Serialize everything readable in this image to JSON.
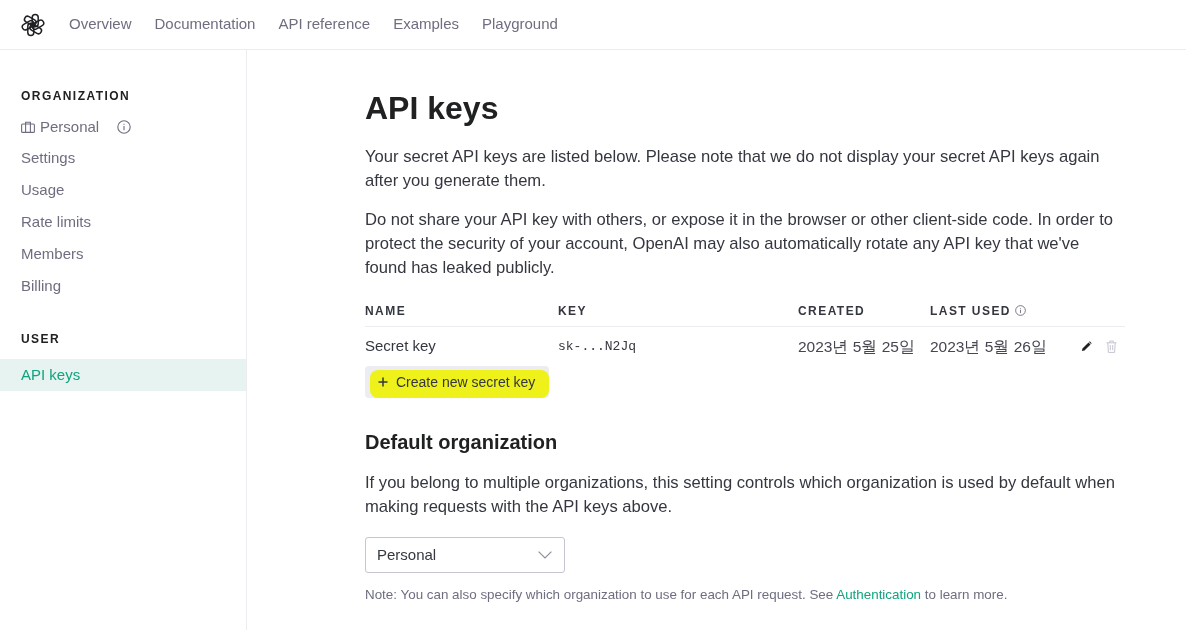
{
  "nav": {
    "items": [
      "Overview",
      "Documentation",
      "API reference",
      "Examples",
      "Playground"
    ]
  },
  "sidebar": {
    "sections": [
      {
        "heading": "ORGANIZATION",
        "items": [
          {
            "kind": "org",
            "label": "Personal",
            "selected": false
          },
          {
            "kind": "link",
            "label": "Settings",
            "selected": false
          },
          {
            "kind": "link",
            "label": "Usage",
            "selected": false
          },
          {
            "kind": "link",
            "label": "Rate limits",
            "selected": false
          },
          {
            "kind": "link",
            "label": "Members",
            "selected": false
          },
          {
            "kind": "link",
            "label": "Billing",
            "selected": false
          }
        ]
      },
      {
        "heading": "USER",
        "items": [
          {
            "kind": "link",
            "label": "API keys",
            "selected": true
          }
        ]
      }
    ]
  },
  "main": {
    "title": "API keys",
    "paragraphs": [
      "Your secret API keys are listed below. Please note that we do not display your secret API keys again after you generate them.",
      "Do not share your API key with others, or expose it in the browser or other client-side code. In order to protect the security of your account, OpenAI may also automatically rotate any API key that we've found has leaked publicly."
    ],
    "table": {
      "columns": [
        {
          "label": "NAME",
          "info": false
        },
        {
          "label": "KEY",
          "info": false
        },
        {
          "label": "CREATED",
          "info": false
        },
        {
          "label": "LAST USED",
          "info": true
        }
      ],
      "rows": [
        {
          "name": "Secret key",
          "key": "sk-...N2Jq",
          "created": "2023년 5월 25일",
          "last_used": "2023년 5월 26일"
        }
      ]
    },
    "create_button": {
      "label": "Create new secret key",
      "highlighted": true
    },
    "default_org": {
      "title": "Default organization",
      "description": "If you belong to multiple organizations, this setting controls which organization is used by default when making requests with the API keys above.",
      "select": {
        "value": "Personal"
      },
      "note": {
        "before": "Note: You can also specify which organization to use for each API request. See ",
        "link": "Authentication",
        "after": " to learn more."
      }
    }
  }
}
